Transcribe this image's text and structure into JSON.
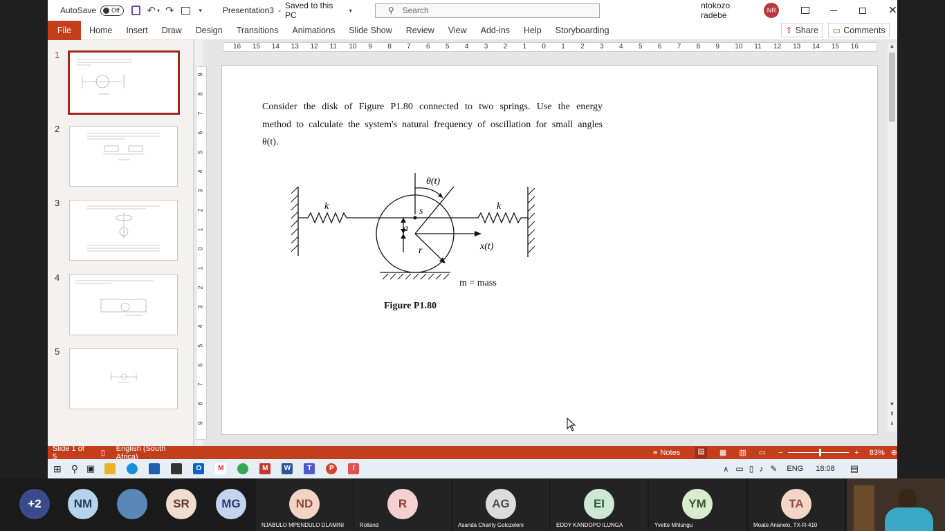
{
  "titlebar": {
    "autosave_label": "AutoSave",
    "autosave_state": "Off",
    "doc_title": "Presentation3",
    "save_status": "Saved to this PC",
    "search_placeholder": "Search",
    "user_name": "ntokozo radebe",
    "user_initials": "NR"
  },
  "ribbon": {
    "tabs": [
      "File",
      "Home",
      "Insert",
      "Draw",
      "Design",
      "Transitions",
      "Animations",
      "Slide Show",
      "Review",
      "View",
      "Add-ins",
      "Help",
      "Storyboarding"
    ],
    "share": "Share",
    "comments": "Comments"
  },
  "ruler": {
    "marks": [
      "16",
      "15",
      "14",
      "13",
      "12",
      "11",
      "10",
      "9",
      "8",
      "7",
      "6",
      "5",
      "4",
      "3",
      "2",
      "1",
      "0",
      "1",
      "2",
      "3",
      "4",
      "5",
      "6",
      "7",
      "8",
      "9",
      "10",
      "11",
      "12",
      "13",
      "14",
      "15",
      "16"
    ],
    "vmarks": [
      "9",
      "8",
      "7",
      "6",
      "5",
      "4",
      "3",
      "2",
      "1",
      "0",
      "1",
      "2",
      "3",
      "4",
      "5",
      "6",
      "7",
      "8",
      "9"
    ]
  },
  "thumbnails": [
    {
      "num": "1"
    },
    {
      "num": "2"
    },
    {
      "num": "3"
    },
    {
      "num": "4"
    },
    {
      "num": "5"
    }
  ],
  "slide": {
    "line1": "Consider the disk of Figure P1.80 connected to two springs.  Use the energy",
    "line2": "method to calculate the system's natural frequency of oscillation for small angles",
    "line3": "θ(t).",
    "fig_theta": "θ(t)",
    "fig_k_left": "k",
    "fig_k_right": "k",
    "fig_s": "s",
    "fig_a": "a",
    "fig_r": "r",
    "fig_x": "x(t)",
    "fig_mass": "m = mass",
    "caption": "Figure P1.80"
  },
  "status": {
    "slide_of": "Slide 1 of 5",
    "language": "English (South Africa)",
    "notes": "Notes",
    "zoom": "83%"
  },
  "taskbar": {
    "lang": "ENG",
    "time": "18:08"
  },
  "participants": [
    {
      "initials": "+2",
      "name": "",
      "color": "#3a4a8a",
      "fg": "#ffffff"
    },
    {
      "initials": "NM",
      "name": "",
      "color": "#b7d3ec",
      "fg": "#1e3c5a"
    },
    {
      "initials": "",
      "name": "",
      "color": "#6a8fb3",
      "fg": "#ffffff"
    },
    {
      "initials": "SR",
      "name": "",
      "color": "#f0ddd0",
      "fg": "#5a3a2a"
    },
    {
      "initials": "MG",
      "name": "",
      "color": "#c4d4ee",
      "fg": "#2a3a6a"
    },
    {
      "initials": "ND",
      "name": "NJABULO MPENDULO DLAMINI",
      "color": "#f4d2c4",
      "fg": "#8a4a3a"
    },
    {
      "initials": "R",
      "name": "Rolland",
      "color": "#f4d0d0",
      "fg": "#8a3a3a"
    },
    {
      "initials": "AG",
      "name": "Asanda Charity Golozeleni",
      "color": "#dcdcdc",
      "fg": "#4a4a4a"
    },
    {
      "initials": "EI",
      "name": "EDDY KANDOPO ILUNGA",
      "color": "#cfe8d6",
      "fg": "#2a5a3a"
    },
    {
      "initials": "YM",
      "name": "Yvette Mhlungu",
      "color": "#d8ecd0",
      "fg": "#3a5a2a"
    },
    {
      "initials": "TA",
      "name": "Moate Ananelo, TX-R-410",
      "color": "#f4d6c8",
      "fg": "#8a4a3a"
    }
  ]
}
